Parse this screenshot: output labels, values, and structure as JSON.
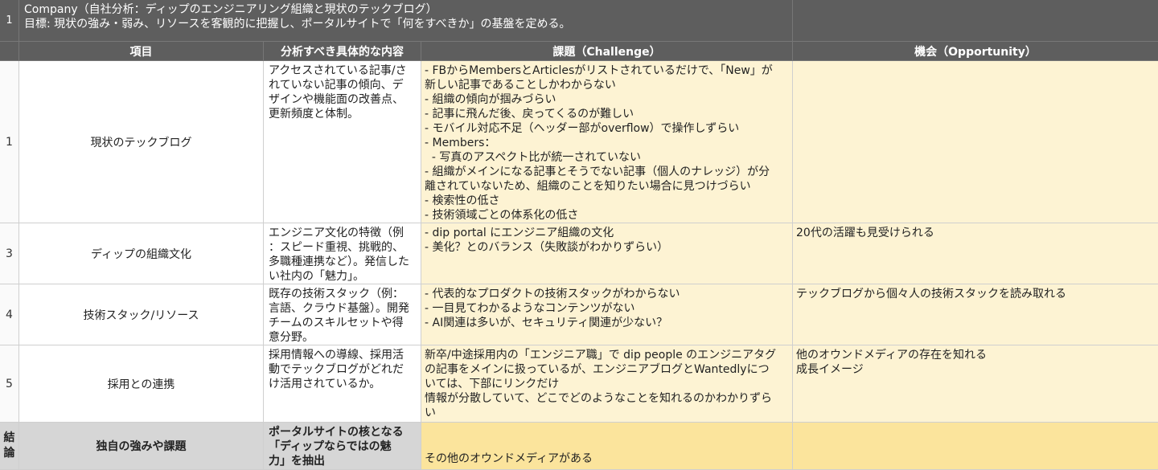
{
  "title": {
    "row_number": "1",
    "line1": "Company（自社分析：ディップのエンジニアリング組織と現状のテックブログ）",
    "line2": "目標: 現状の強み・弱み、リソースを客観的に把握し、ポータルサイトで「何をすべきか」の基盤を定める。"
  },
  "headers": {
    "item": "項目",
    "detail": "分析すべき具体的な内容",
    "challenge": "課題（Challenge）",
    "opportunity": "機会（Opportunity）"
  },
  "rows": [
    {
      "num": "1",
      "item": "現状のテックブログ",
      "detail": [
        "アクセスされている記事/さ",
        "れていない記事の傾向、デ",
        "ザインや機能面の改善点、",
        "更新頻度と体制。"
      ],
      "challenge": [
        "- FBからMembersとArticlesがリストされているだけで、「New」が",
        "新しい記事であることしかわからない",
        "- 組織の傾向が掴みづらい",
        "- 記事に飛んだ後、戻ってくるのが難しい",
        "- モバイル対応不足（ヘッダー部がoverflow）で操作しずらい",
        "- Members：",
        "  - 写真のアスペクト比が統一されていない",
        "- 組織がメインになる記事とそうでない記事（個人のナレッジ）が分",
        "離されていないため、組織のことを知りたい場合に見つけづらい",
        "- 検索性の低さ",
        "- 技術領域ごとの体系化の低さ"
      ],
      "opportunity": []
    },
    {
      "num": "3",
      "item": "ディップの組織文化",
      "detail": [
        "エンジニア文化の特徴（例",
        "：スピード重視、挑戦的、",
        "多職種連携など）。発信した",
        "い社内の「魅力」。"
      ],
      "challenge": [
        "- dip portal にエンジニア組織の文化",
        "- 美化？とのバランス（失敗談がわかりずらい）"
      ],
      "opportunity": [
        "20代の活躍も見受けられる"
      ]
    },
    {
      "num": "4",
      "item": "技術スタック/リソース",
      "detail": [
        "既存の技術スタック（例：",
        "言語、クラウド基盤）。開発",
        "チームのスキルセットや得",
        "意分野。"
      ],
      "challenge": [
        "- 代表的なプロダクトの技術スタックがわからない",
        "- 一目見てわかるようなコンテンツがない",
        "- AI関連は多いが、セキュリティ関連が少ない？"
      ],
      "opportunity": [
        "テックブログから個々人の技術スタックを読み取れる"
      ]
    },
    {
      "num": "5",
      "item": "採用との連携",
      "detail": [
        "採用情報への導線、採用活",
        "動でテックブログがどれだ",
        "け活用されているか。"
      ],
      "challenge": [
        "新卒/中途採用内の「エンジニア職」で dip people のエンジニアタグ",
        "の記事をメインに扱っているが、エンジニアブログとWantedlyにつ",
        "いては、下部にリンクだけ",
        "情報が分散していて、どこでどのようなことを知れるのかわかりずら",
        "い"
      ],
      "opportunity": [
        "他のオウンドメディアの存在を知れる",
        "成長イメージ"
      ]
    }
  ],
  "conclusion": {
    "label_line1": "結",
    "label_line2": "論",
    "item": "独自の強みや課題",
    "detail": [
      "ポータルサイトの核となる",
      "「ディップならではの魅",
      "力」を抽出"
    ],
    "challenge": "その他のオウンドメディアがある",
    "opportunity": ""
  }
}
